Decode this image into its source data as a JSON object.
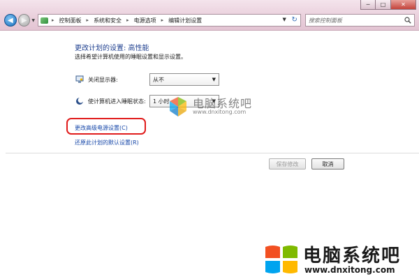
{
  "window": {
    "minimize_label": "─",
    "maximize_label": "□",
    "close_label": "✕"
  },
  "address_bar": {
    "breadcrumbs": [
      "控制面板",
      "系统和安全",
      "电源选项",
      "编辑计划设置"
    ]
  },
  "search": {
    "placeholder": "搜索控制面板"
  },
  "main": {
    "title": "更改计划的设置: 高性能",
    "subtitle": "选择希望计算机使用的睡眠设置和显示设置。",
    "settings": [
      {
        "label": "关闭显示器:",
        "value": "从不",
        "icon": "monitor-icon"
      },
      {
        "label": "使计算机进入睡眠状态:",
        "value": "1 小时",
        "icon": "moon-icon"
      }
    ],
    "advanced_link": "更改高级电源设置(C)",
    "restore_link": "还原此计划的默认设置(R)",
    "save_button": "保存修改",
    "cancel_button": "取消"
  },
  "watermark": {
    "name": "电脑系统吧",
    "url": "www.dnxitong.com"
  },
  "colors": {
    "title_bar": "#eacfdc",
    "heading": "#1e3f8f",
    "link": "#1546a8",
    "highlight": "#e01b1b",
    "logo_red": "#f25022",
    "logo_green": "#7fba00",
    "logo_blue": "#00a4ef",
    "logo_yellow": "#ffb900"
  }
}
